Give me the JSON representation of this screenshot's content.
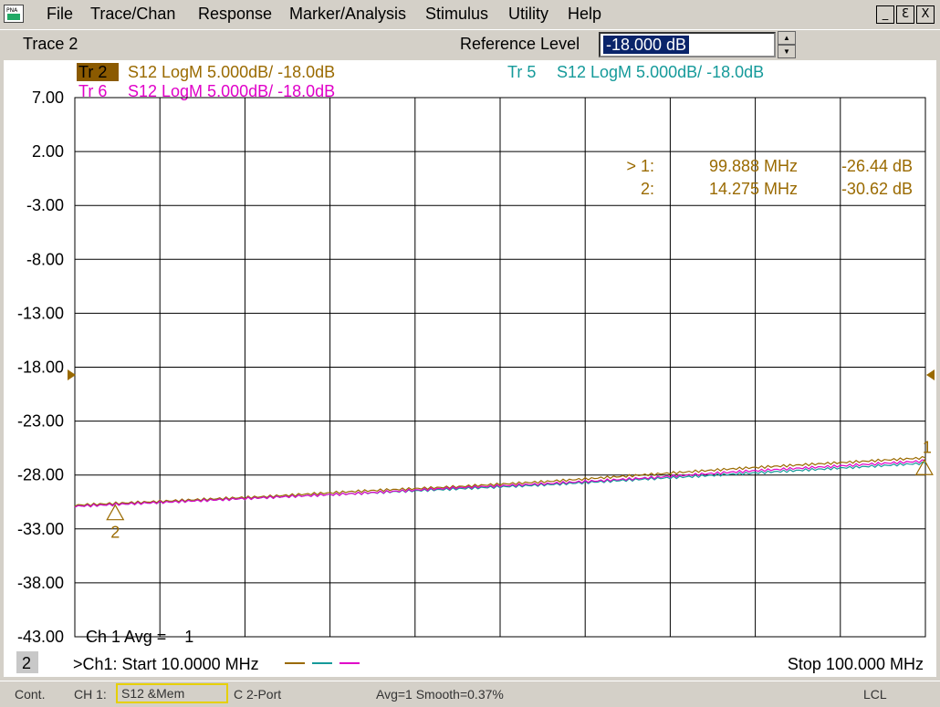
{
  "menu": {
    "items": [
      "File",
      "Trace/Chan",
      "Response",
      "Marker/Analysis",
      "Stimulus",
      "Utility",
      "Help"
    ],
    "icon": "pna-app-icon",
    "app_icon_text": "PNA",
    "window_buttons": [
      "_",
      "Ɛ",
      "X"
    ]
  },
  "toolbar": {
    "active_trace": "Trace 2",
    "field_label": "Reference Level",
    "field_value": "-18.000 dB"
  },
  "traces": [
    {
      "badge": "Tr 2",
      "desc": "S12 LogM 5.000dB/  -18.0dB",
      "color": "#9a6a00",
      "active": true
    },
    {
      "badge": "Tr 5",
      "desc": "S12 LogM 5.000dB/  -18.0dB",
      "color": "#159a9a",
      "active": false
    },
    {
      "badge": "Tr 6",
      "desc": "S12 LogM 5.000dB/  -18.0dB",
      "color": "#e000c8",
      "active": false
    }
  ],
  "markers": [
    {
      "label": "> 1:",
      "freq": "99.888 MHz",
      "value": "-26.44 dB"
    },
    {
      "label": "2:",
      "freq": "14.275 MHz",
      "value": "-30.62 dB"
    }
  ],
  "chart_data": {
    "type": "line",
    "xlabel": "",
    "ylabel": "",
    "x_range_mhz": [
      10,
      100
    ],
    "y_range_db": [
      -43,
      7
    ],
    "y_ticks": [
      "7.00",
      "2.00",
      "-3.00",
      "-8.00",
      "-13.00",
      "-18.00",
      "-23.00",
      "-28.00",
      "-33.00",
      "-38.00",
      "-43.00"
    ],
    "grid": true,
    "reference_level_db": -18,
    "series": [
      {
        "name": "Tr 2",
        "color": "#9a6a00",
        "x": [
          10,
          20,
          30,
          40,
          50,
          60,
          70,
          80,
          90,
          100
        ],
        "y": [
          -30.8,
          -30.4,
          -30.0,
          -29.5,
          -29.1,
          -28.6,
          -28.0,
          -27.4,
          -26.9,
          -26.4
        ]
      },
      {
        "name": "Tr 5",
        "color": "#159a9a",
        "x": [
          10,
          20,
          30,
          40,
          50,
          60,
          70,
          80,
          90,
          100
        ],
        "y": [
          -30.9,
          -30.5,
          -30.1,
          -29.7,
          -29.3,
          -28.9,
          -28.4,
          -27.9,
          -27.4,
          -26.9
        ]
      },
      {
        "name": "Tr 6",
        "color": "#e000c8",
        "x": [
          10,
          20,
          30,
          40,
          50,
          60,
          70,
          80,
          90,
          100
        ],
        "y": [
          -30.9,
          -30.5,
          -30.1,
          -29.7,
          -29.2,
          -28.8,
          -28.3,
          -27.7,
          -27.2,
          -26.7
        ]
      }
    ],
    "marker_points": [
      {
        "label": "1",
        "x": 99.888,
        "y": -26.44
      },
      {
        "label": "2",
        "x": 14.275,
        "y": -30.62
      }
    ]
  },
  "footer": {
    "channel_number": "2",
    "avg_text": "Ch 1 Avg =    1",
    "start_text": ">Ch1: Start  10.0000 MHz",
    "stop_text": "Stop  100.000 MHz"
  },
  "status": {
    "mode": "Cont.",
    "channel": "CH 1:",
    "meas": "S12 &Mem",
    "port": "C  2-Port",
    "avg": "Avg=1 Smooth=0.37%",
    "lcl": "LCL"
  }
}
